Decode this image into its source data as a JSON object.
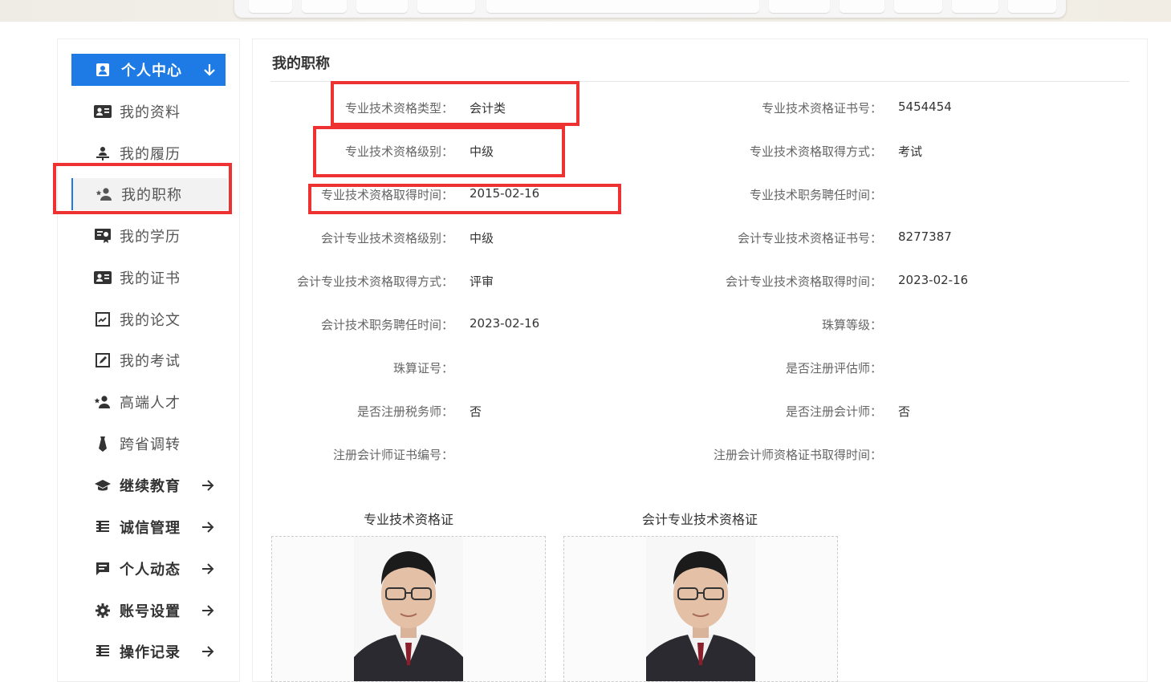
{
  "sidebar": {
    "header": {
      "label": "个人中心"
    },
    "items": [
      {
        "label": "我的资料",
        "icon": "id-card-icon"
      },
      {
        "label": "我的履历",
        "icon": "person-podium-icon"
      },
      {
        "label": "我的职称",
        "icon": "person-star-icon",
        "active": true
      },
      {
        "label": "我的学历",
        "icon": "certificate-icon"
      },
      {
        "label": "我的证书",
        "icon": "id-card-icon"
      },
      {
        "label": "我的论文",
        "icon": "document-chart-icon"
      },
      {
        "label": "我的考试",
        "icon": "edit-square-icon"
      },
      {
        "label": "高端人才",
        "icon": "person-star-icon"
      },
      {
        "label": "跨省调转",
        "icon": "tie-icon"
      },
      {
        "label": "继续教育",
        "icon": "graduation-cap-icon"
      },
      {
        "label": "诚信管理",
        "icon": "list-icon"
      },
      {
        "label": "个人动态",
        "icon": "message-icon"
      },
      {
        "label": "账号设置",
        "icon": "gear-icon"
      },
      {
        "label": "操作记录",
        "icon": "list-icon"
      }
    ]
  },
  "main": {
    "title": "我的职称",
    "fields": [
      {
        "key": "专业技术资格类型：",
        "value": "会计类"
      },
      {
        "key": "专业技术资格证书号：",
        "value": "5454454"
      },
      {
        "key": "专业技术资格级别：",
        "value": "中级"
      },
      {
        "key": "专业技术资格取得方式：",
        "value": "考试"
      },
      {
        "key": "专业技术资格取得时间：",
        "value": "2015-02-16"
      },
      {
        "key": "专业技术职务聘任时间：",
        "value": ""
      },
      {
        "key": "会计专业技术资格级别：",
        "value": "中级"
      },
      {
        "key": "会计专业技术资格证书号：",
        "value": "8277387"
      },
      {
        "key": "会计专业技术资格取得方式：",
        "value": "评审"
      },
      {
        "key": "会计专业技术资格取得时间：",
        "value": "2023-02-16"
      },
      {
        "key": "会计技术职务聘任时间：",
        "value": "2023-02-16"
      },
      {
        "key": "珠算等级：",
        "value": ""
      },
      {
        "key": "珠算证号：",
        "value": ""
      },
      {
        "key": "是否注册评估师：",
        "value": ""
      },
      {
        "key": "是否注册税务师：",
        "value": "否"
      },
      {
        "key": "是否注册会计师：",
        "value": "否"
      },
      {
        "key": "注册会计师证书编号：",
        "value": ""
      },
      {
        "key": "注册会计师资格证书取得时间：",
        "value": ""
      }
    ],
    "certificates": [
      {
        "title": "专业技术资格证"
      },
      {
        "title": "会计专业技术资格证"
      }
    ]
  },
  "colors": {
    "accent": "#1e7be6",
    "highlight": "#ee3131"
  }
}
